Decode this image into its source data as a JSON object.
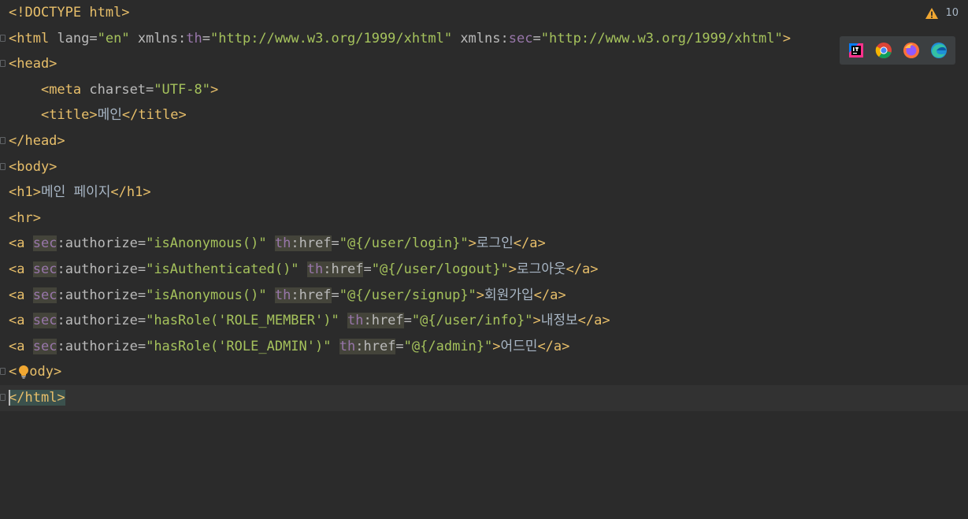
{
  "warnings": {
    "count": "10",
    "icon": "warning-triangle-icon",
    "color": "#f0a732"
  },
  "browsers": [
    {
      "name": "IntelliJ",
      "icon": "intellij-icon"
    },
    {
      "name": "Chrome",
      "icon": "chrome-icon"
    },
    {
      "name": "Firefox",
      "icon": "firefox-icon"
    },
    {
      "name": "Edge",
      "icon": "edge-icon"
    }
  ],
  "colors": {
    "background": "#2b2b2b",
    "tag": "#e8bf6a",
    "attribute": "#bababa",
    "namespace": "#9876aa",
    "string": "#a5c25c",
    "text": "#a9b7c6",
    "highlight": "#44443a"
  },
  "code": {
    "l1": {
      "doctype": "<!DOCTYPE html>"
    },
    "l2": {
      "open": "<html",
      "lang_attr": "lang",
      "lang_val": "\"en\"",
      "xmlns": "xmlns",
      "th_ns": "th",
      "th_val": "\"http://www.w3.org/1999/xhtml\"",
      "xmlns2": "xmlns",
      "sec_ns": "sec",
      "sec_val": "\"http://www.w3.org/1999/xhtml\"",
      "close": ">"
    },
    "l3": {
      "tag": "<head>"
    },
    "l4": {
      "open": "<meta",
      "attr": "charset",
      "val": "\"UTF-8\"",
      "close": ">"
    },
    "l5": {
      "open": "<title>",
      "text": "메인",
      "close": "</title>"
    },
    "l6": {
      "tag": "</head>"
    },
    "l7": {
      "tag": "<body>"
    },
    "l8": {
      "open": "<h1>",
      "text": "메인 페이지",
      "close": "</h1>"
    },
    "l9": {
      "tag": "<hr>"
    },
    "links": [
      {
        "open": "<a",
        "sec": "sec",
        "authorize": "authorize",
        "auth_val": "\"isAnonymous()\"",
        "th": "th",
        "href": "href",
        "href_val": "\"@{/user/login}\"",
        "gt": ">",
        "text": "로그인",
        "close": "</a>"
      },
      {
        "open": "<a",
        "sec": "sec",
        "authorize": "authorize",
        "auth_val": "\"isAuthenticated()\"",
        "th": "th",
        "href": "href",
        "href_val": "\"@{/user/logout}\"",
        "gt": ">",
        "text": "로그아웃",
        "close": "</a>"
      },
      {
        "open": "<a",
        "sec": "sec",
        "authorize": "authorize",
        "auth_val": "\"isAnonymous()\"",
        "th": "th",
        "href": "href",
        "href_val": "\"@{/user/signup}\"",
        "gt": ">",
        "text": "회원가입",
        "close": "</a>"
      },
      {
        "open": "<a",
        "sec": "sec",
        "authorize": "authorize",
        "auth_val": "\"hasRole('ROLE_MEMBER')\"",
        "th": "th",
        "href": "href",
        "href_val": "\"@{/user/info}\"",
        "gt": ">",
        "text": "내정보",
        "close": "</a>"
      },
      {
        "open": "<a",
        "sec": "sec",
        "authorize": "authorize",
        "auth_val": "\"hasRole('ROLE_ADMIN')\"",
        "th": "th",
        "href": "href",
        "href_val": "\"@{/admin}\"",
        "gt": ">",
        "text": "어드민",
        "close": "</a>"
      }
    ],
    "l15": {
      "start": "<",
      "rest": "ody>"
    },
    "l16": {
      "start": "<",
      "rest": "/html>"
    }
  }
}
